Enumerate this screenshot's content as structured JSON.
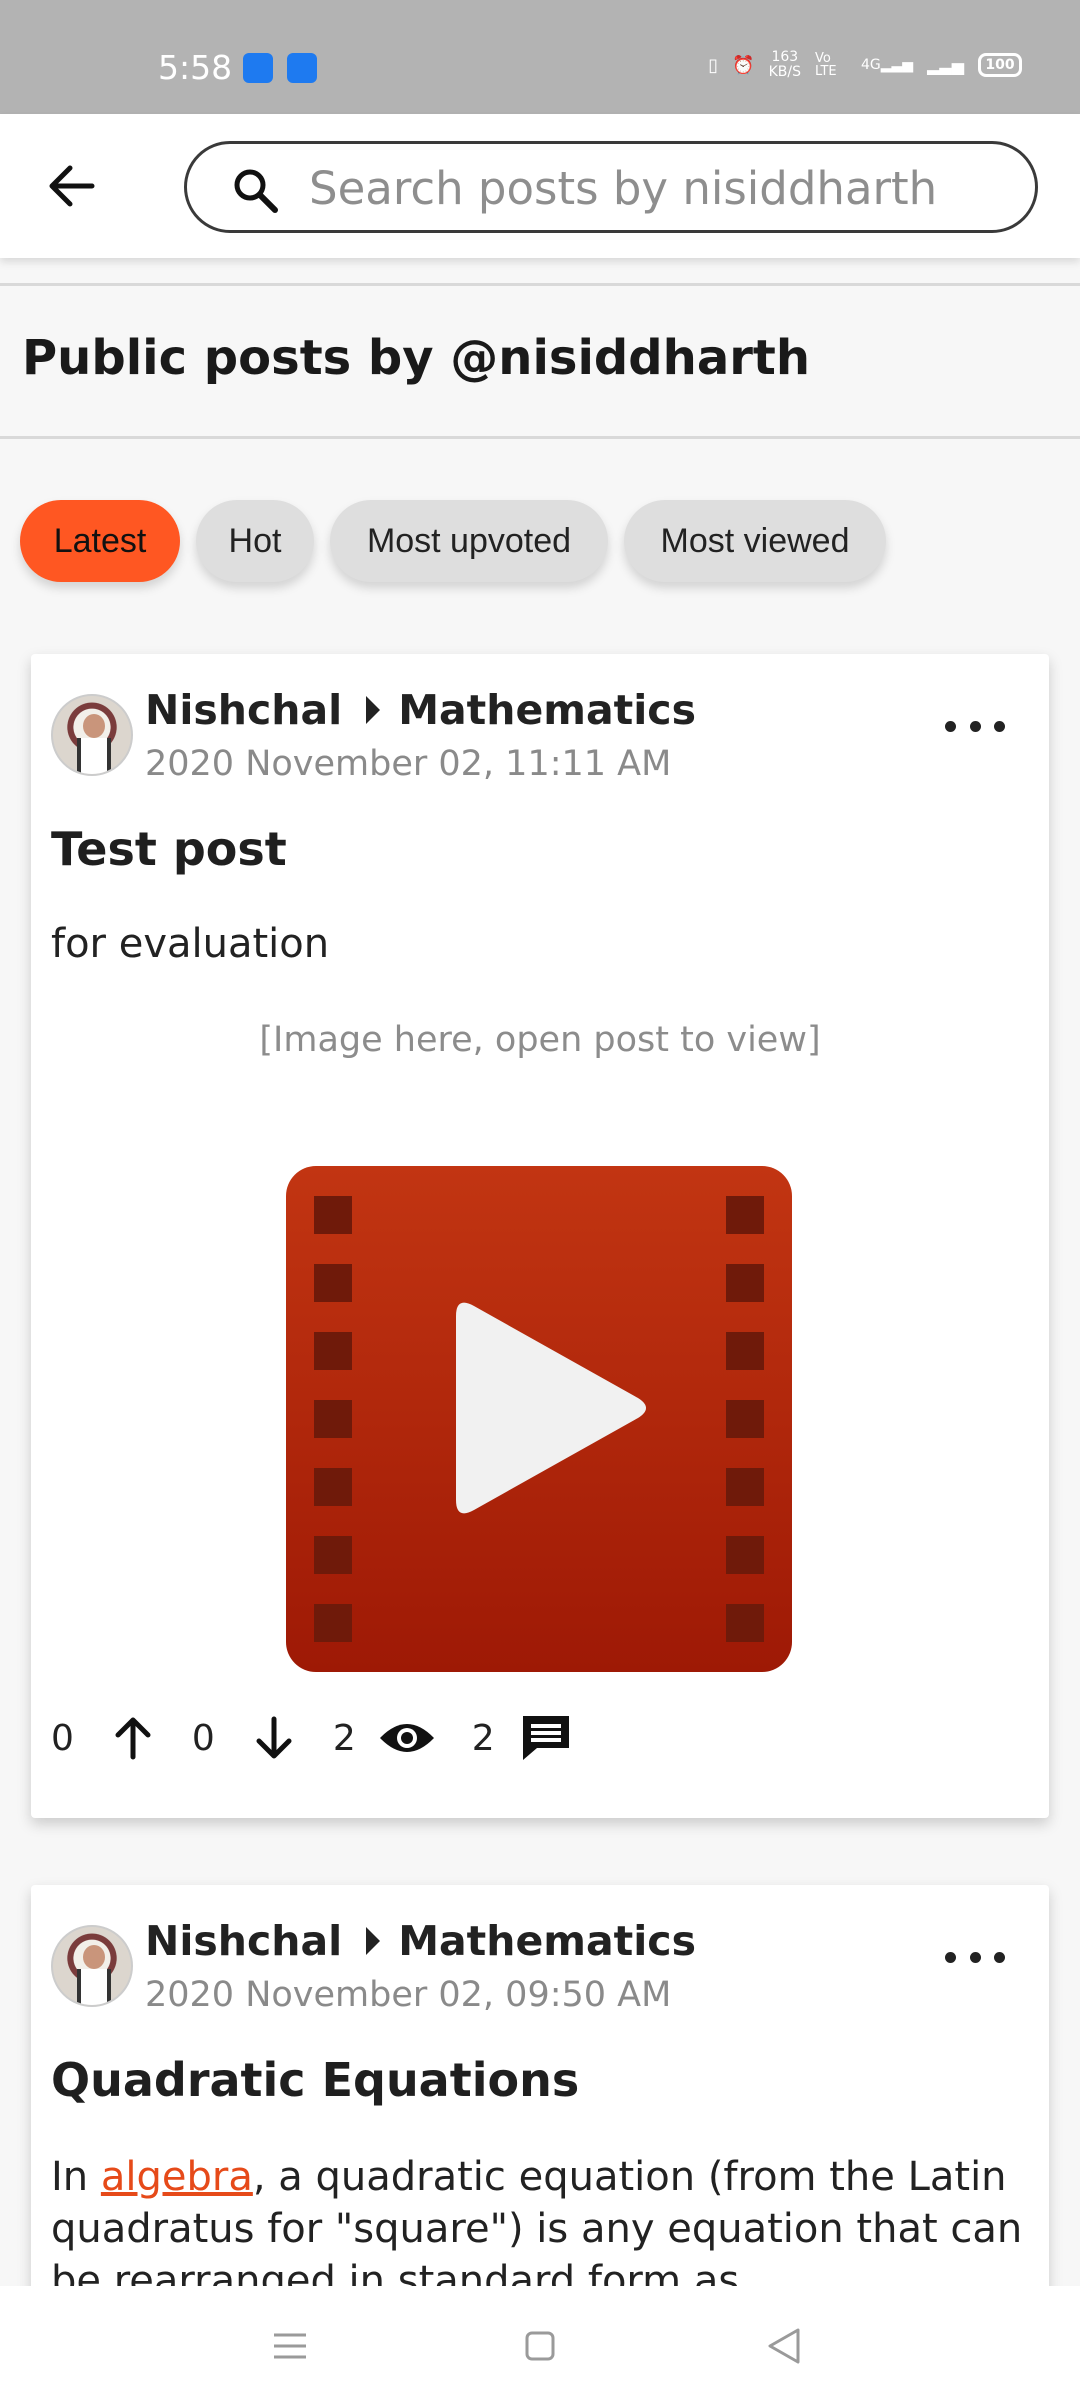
{
  "status_bar": {
    "time": "5:58",
    "net_speed_value": "163",
    "net_speed_unit": "KB/S",
    "volte": "Vo LTE",
    "network": "4G",
    "battery": "100"
  },
  "app_bar": {
    "search_placeholder": "Search posts by nisiddharth"
  },
  "page": {
    "title": "Public posts by @nisiddharth"
  },
  "sort_chips": [
    {
      "label": "Latest",
      "active": true
    },
    {
      "label": "Hot",
      "active": false
    },
    {
      "label": "Most upvoted",
      "active": false
    },
    {
      "label": "Most viewed",
      "active": false
    }
  ],
  "posts": [
    {
      "author": "Nishchal",
      "category": "Mathematics",
      "date": "2020 November 02, 11:11 AM",
      "title": "Test post",
      "body": "for evaluation",
      "image_note": "[Image here, open post to view]",
      "upvotes": "0",
      "downvotes": "0",
      "views": "2",
      "comments": "2"
    },
    {
      "author": "Nishchal",
      "category": "Mathematics",
      "date": "2020 November 02, 09:50 AM",
      "title": "Quadratic Equations",
      "body_prefix": "In ",
      "body_link": "algebra",
      "body_suffix": ", a quadratic equation (from the Latin quadratus for \"square\") is any equation that can be rearranged in standard form as"
    }
  ],
  "colors": {
    "accent": "#ff5722",
    "link": "#e64a19",
    "video_red": "#b52a10"
  }
}
